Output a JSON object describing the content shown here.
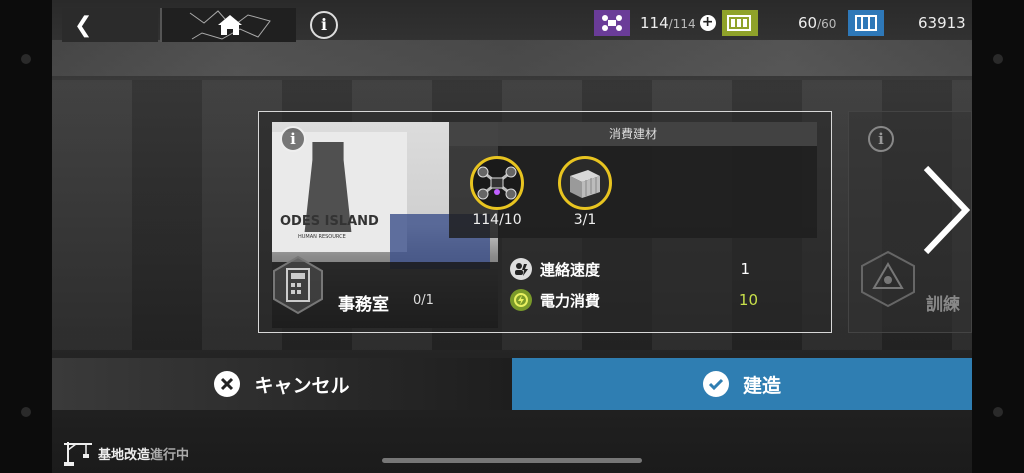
{
  "header": {
    "back_icon": "chevron-left-icon",
    "home_icon": "home-icon",
    "info_glyph": "i"
  },
  "resources": {
    "drone": {
      "icon": "drone-icon",
      "current": "114",
      "max": "/114",
      "color": "#6a3c98"
    },
    "power": {
      "icon": "battery-icon",
      "current": "60",
      "max": "/60",
      "color": "#8fa22a"
    },
    "materials": {
      "icon": "crate-icon",
      "value": "63913",
      "color": "#2e78b8"
    }
  },
  "room": {
    "info_glyph": "i",
    "sign_text": "ODES ISLAND",
    "sign_sub": "HUMAN RESOURCE",
    "name": "事務室",
    "count": "0/1",
    "icon": "calculator-icon"
  },
  "materials_panel": {
    "header": "消費建材",
    "items": [
      {
        "icon": "drone-icon",
        "label": "114/10"
      },
      {
        "icon": "crate-icon",
        "label": "3/1"
      }
    ]
  },
  "stats": [
    {
      "icon": "contact-speed-icon",
      "name": "連絡速度",
      "value": "1"
    },
    {
      "icon": "power-icon",
      "name": "電力消費",
      "value": "10"
    }
  ],
  "next_panel": {
    "info_glyph": "i",
    "label": "訓練",
    "icon": "training-icon"
  },
  "actions": {
    "cancel_label": "キャンセル",
    "confirm_label": "建造",
    "accent": "#2f7eb2"
  },
  "footer": {
    "label_main": "基地改造",
    "label_status": "進行中",
    "icon": "crane-icon"
  }
}
